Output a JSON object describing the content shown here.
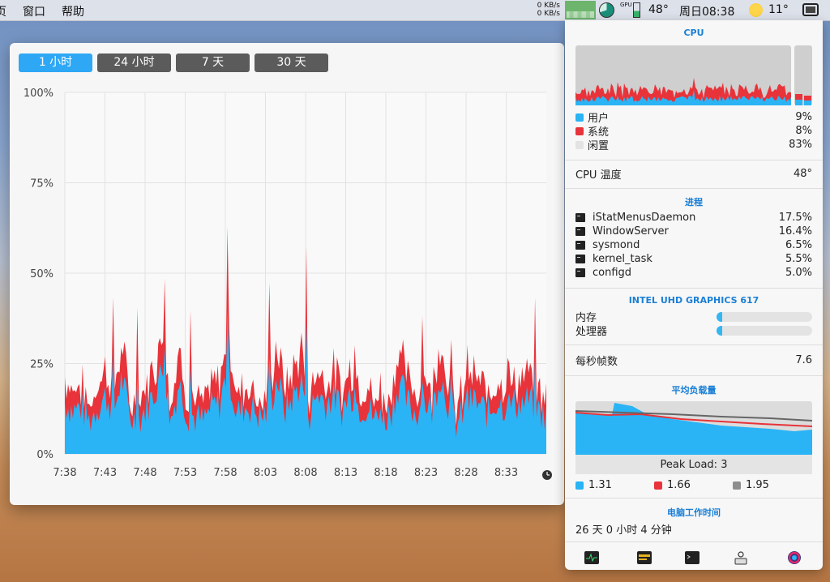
{
  "menubar": {
    "items": [
      "页",
      "窗口",
      "帮助"
    ],
    "net_up": "0 KB/s",
    "net_down": "0 KB/s",
    "gpu_label": "GPU",
    "temp": "48°",
    "datetime": "周日08:38",
    "weather": "11°"
  },
  "graph": {
    "tabs": [
      "1 小时",
      "24 小时",
      "7 天",
      "30 天"
    ],
    "active_tab": 0
  },
  "chart_data": {
    "type": "area",
    "title": "",
    "y_ticks": [
      "100%",
      "75%",
      "50%",
      "25%",
      "0%"
    ],
    "x_ticks": [
      "7:38",
      "7:43",
      "7:48",
      "7:53",
      "7:58",
      "8:03",
      "8:08",
      "8:13",
      "8:18",
      "8:23",
      "8:28",
      "8:33"
    ],
    "ylim": [
      0,
      100
    ],
    "grid": true,
    "series": [
      {
        "name": "用户",
        "color": "#2ab4f5",
        "values": [
          14,
          12,
          13,
          9,
          13,
          16,
          12,
          21,
          10,
          9,
          13,
          17,
          24,
          9,
          20,
          11,
          10,
          9,
          13,
          14,
          24,
          11,
          13,
          13,
          10,
          12,
          21,
          12,
          16,
          20,
          11,
          17,
          14,
          16,
          12,
          17,
          13,
          13,
          10,
          9,
          12,
          20,
          14,
          11,
          15,
          12,
          22,
          14,
          8,
          12,
          15,
          13,
          11,
          15,
          13,
          14,
          14,
          15,
          12,
          10
        ]
      },
      {
        "name": "系统",
        "color": "#e8333a",
        "values": [
          6,
          5,
          5,
          3,
          5,
          7,
          4,
          8,
          3,
          3,
          5,
          6,
          9,
          4,
          8,
          4,
          4,
          3,
          5,
          5,
          9,
          4,
          5,
          5,
          3,
          4,
          8,
          5,
          6,
          8,
          4,
          6,
          5,
          6,
          4,
          6,
          5,
          5,
          3,
          3,
          5,
          8,
          6,
          4,
          6,
          4,
          9,
          5,
          3,
          5,
          6,
          5,
          4,
          6,
          5,
          5,
          5,
          6,
          5,
          4
        ]
      }
    ]
  },
  "panel": {
    "cpu_title": "CPU",
    "legend": [
      {
        "label": "用户",
        "value": "9%",
        "color": "#2ab4f5"
      },
      {
        "label": "系统",
        "value": "8%",
        "color": "#e8333a"
      },
      {
        "label": "闲置",
        "value": "83%",
        "color": "#e3e3e3"
      }
    ],
    "cpu_temp_label": "CPU 温度",
    "cpu_temp_value": "48°",
    "proc_title": "进程",
    "processes": [
      {
        "name": "iStatMenusDaemon",
        "value": "17.5%"
      },
      {
        "name": "WindowServer",
        "value": "16.4%"
      },
      {
        "name": "sysmond",
        "value": "6.5%"
      },
      {
        "name": "kernel_task",
        "value": "5.5%"
      },
      {
        "name": "configd",
        "value": "5.0%"
      }
    ],
    "gpu_title": "INTEL UHD GRAPHICS 617",
    "gpu_rows": [
      {
        "label": "内存",
        "fraction": 0.05
      },
      {
        "label": "处理器",
        "fraction": 0.05
      }
    ],
    "fps_label": "每秒帧数",
    "fps_value": "7.6",
    "load_title": "平均负载量",
    "peak_load": "Peak Load: 3",
    "load_values": [
      {
        "value": "1.31",
        "color": "#2ab4f5"
      },
      {
        "value": "1.66",
        "color": "#e8333a"
      },
      {
        "value": "1.95",
        "color": "#8e8e8e"
      }
    ],
    "uptime_title": "电脑工作时间",
    "uptime_value": "26 天 0 小时 4 分钟"
  }
}
